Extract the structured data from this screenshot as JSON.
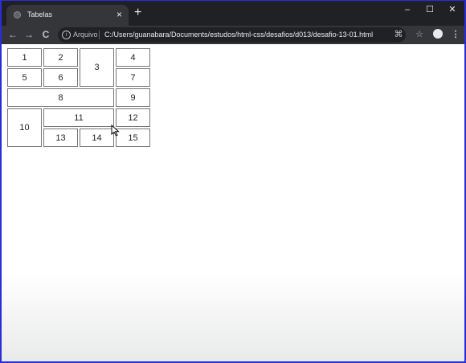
{
  "tab": {
    "title": "Tabelas",
    "close": "×"
  },
  "new_tab": "+",
  "window_controls": {
    "minimize": "–",
    "maximize": "☐",
    "close": "✕"
  },
  "nav": {
    "back": "←",
    "forward": "→",
    "reload": "C"
  },
  "address": {
    "scheme_label": "Arquivo",
    "url": "C:/Users/guanabara/Documents/estudos/html-css/desafios/d013/desafio-13-01.html"
  },
  "toolbar_icons": [
    "translate-icon",
    "star-icon",
    "profile-icon",
    "menu-icon"
  ],
  "table": {
    "cells": [
      "1",
      "2",
      "3",
      "4",
      "5",
      "6",
      "7",
      "8",
      "9",
      "10",
      "11",
      "12",
      "13",
      "14",
      "15"
    ]
  }
}
